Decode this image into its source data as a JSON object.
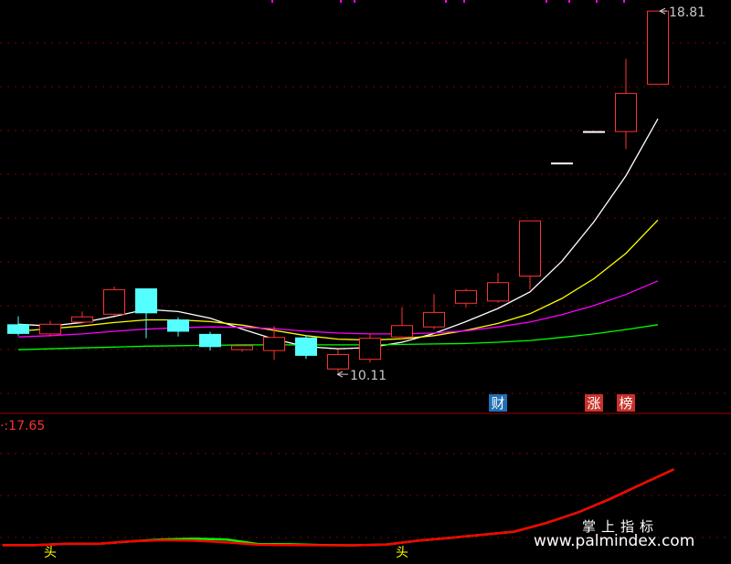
{
  "chart_data": [
    {
      "type": "candlestick",
      "price_range": [
        9.0,
        19.0
      ],
      "candles": [
        {
          "open": 11.66,
          "close": 11.44,
          "high": 11.84,
          "low": 11.4
        },
        {
          "open": 11.44,
          "close": 11.66,
          "high": 11.74,
          "low": 11.38
        },
        {
          "open": 11.71,
          "close": 11.83,
          "high": 11.95,
          "low": 11.68
        },
        {
          "open": 11.89,
          "close": 12.45,
          "high": 12.52,
          "low": 11.86
        },
        {
          "open": 12.48,
          "close": 11.91,
          "high": 12.48,
          "low": 11.34
        },
        {
          "open": 11.77,
          "close": 11.49,
          "high": 11.82,
          "low": 11.38
        },
        {
          "open": 11.44,
          "close": 11.14,
          "high": 11.49,
          "low": 11.06
        },
        {
          "open": 11.08,
          "close": 11.17,
          "high": 11.19,
          "low": 11.03
        },
        {
          "open": 11.06,
          "close": 11.36,
          "high": 11.62,
          "low": 10.85
        },
        {
          "open": 11.36,
          "close": 10.94,
          "high": 11.41,
          "low": 10.87
        },
        {
          "open": 10.64,
          "close": 10.97,
          "high": 11.09,
          "low": 10.56
        },
        {
          "open": 10.86,
          "close": 11.34,
          "high": 11.45,
          "low": 10.79
        },
        {
          "open": 11.37,
          "close": 11.63,
          "high": 12.05,
          "low": 11.32
        },
        {
          "open": 11.6,
          "close": 11.93,
          "high": 12.35,
          "low": 11.55
        },
        {
          "open": 12.14,
          "close": 12.43,
          "high": 12.47,
          "low": 12.04
        },
        {
          "open": 12.19,
          "close": 12.61,
          "high": 12.83,
          "low": 12.15
        },
        {
          "open": 12.76,
          "close": 14.02,
          "high": 14.02,
          "low": 12.45
        },
        {
          "open": 15.33,
          "close": 15.33,
          "high": 15.33,
          "low": 15.33
        },
        {
          "open": 16.05,
          "close": 16.05,
          "high": 16.05,
          "low": 16.05
        },
        {
          "open": 16.06,
          "close": 16.93,
          "high": 17.72,
          "low": 15.66
        },
        {
          "open": 17.14,
          "close": 18.81,
          "high": 18.81,
          "low": 17.14
        }
      ],
      "moving_averages": [
        {
          "color": "#ffffff",
          "values": [
            11.66,
            11.62,
            11.7,
            11.84,
            12.0,
            11.95,
            11.8,
            11.55,
            11.32,
            11.15,
            11.1,
            11.13,
            11.25,
            11.45,
            11.72,
            12.02,
            12.4,
            13.1,
            14.0,
            15.05,
            16.35
          ]
        },
        {
          "color": "#ffff00",
          "values": [
            11.5,
            11.56,
            11.62,
            11.7,
            11.76,
            11.76,
            11.72,
            11.64,
            11.52,
            11.4,
            11.32,
            11.3,
            11.33,
            11.4,
            11.52,
            11.68,
            11.9,
            12.25,
            12.7,
            13.28,
            14.04
          ]
        },
        {
          "color": "#ff00ff",
          "values": [
            11.37,
            11.4,
            11.44,
            11.5,
            11.55,
            11.58,
            11.6,
            11.59,
            11.56,
            11.5,
            11.46,
            11.44,
            11.44,
            11.46,
            11.51,
            11.6,
            11.71,
            11.88,
            12.09,
            12.34,
            12.65
          ]
        },
        {
          "color": "#00ff00",
          "values": [
            11.08,
            11.1,
            11.12,
            11.14,
            11.16,
            11.17,
            11.18,
            11.19,
            11.19,
            11.19,
            11.19,
            11.19,
            11.2,
            11.21,
            11.22,
            11.25,
            11.29,
            11.36,
            11.44,
            11.54,
            11.65
          ]
        }
      ],
      "annotations": {
        "high_label": "18.81",
        "low_label": "10.11"
      },
      "badges": [
        {
          "text": "财",
          "candle_index": 15,
          "color": "#1f6fb5"
        },
        {
          "text": "涨",
          "candle_index": 18,
          "color": "#c8322a"
        },
        {
          "text": "榜",
          "candle_index": 19,
          "color": "#c8322a"
        }
      ]
    },
    {
      "type": "line",
      "value_label": "17.65",
      "line_color": "#ff0000",
      "signal_color": "#00ff00",
      "y_range": [
        0.0,
        17.65
      ],
      "x": [
        -0.5,
        0.5,
        1.5,
        2.5,
        3.5,
        4.5,
        5.5,
        6.5,
        7.5,
        8.5,
        9.5,
        10.5,
        11.5,
        12.5,
        13.5,
        14.5,
        15.5,
        16.5,
        17.5,
        18.5,
        19.5,
        20.5
      ],
      "main_line": [
        0.12,
        0.12,
        0.4,
        0.4,
        0.9,
        1.15,
        1.05,
        0.7,
        0.2,
        0.15,
        0.1,
        0.1,
        0.25,
        1.05,
        1.62,
        2.25,
        2.9,
        4.65,
        6.85,
        9.62,
        12.7,
        15.72
      ],
      "signal_line": [
        0.12,
        0.12,
        0.4,
        0.4,
        0.9,
        1.3,
        1.45,
        1.3,
        0.35,
        0.3,
        0.15,
        0.1,
        0.25,
        1.05,
        1.62,
        2.25,
        2.9,
        4.65,
        6.85,
        9.62,
        12.7,
        15.72
      ],
      "markers": [
        {
          "text": "头",
          "x": 1.0
        },
        {
          "text": "头",
          "x": 12.0
        }
      ]
    }
  ],
  "watermark": {
    "line1": "掌上指标",
    "line2": "www.palmindex.com"
  }
}
